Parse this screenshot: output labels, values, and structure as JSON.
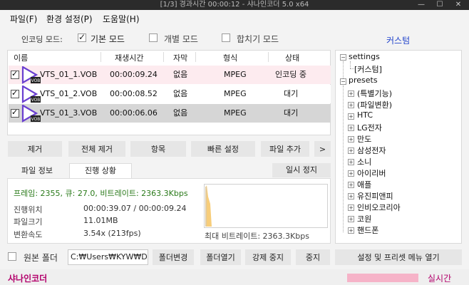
{
  "window": {
    "title": "[1/3] 경과시간 00:00:12 - 샤나인코더 5.0 x64",
    "minimize_glyph": "—",
    "maximize_glyph": "☐",
    "close_glyph": "✕"
  },
  "menu": {
    "file": "파일(F)",
    "settings": "환경 설정(P)",
    "help": "도움말(H)"
  },
  "encoding_mode": {
    "label": "인코딩 모드:",
    "basic": "기본 모드",
    "individual": "개별 모드",
    "merge": "합치기 모드",
    "basic_checked": true,
    "individual_checked": false,
    "merge_checked": false,
    "custom_link": "커스텀"
  },
  "file_list": {
    "headers": {
      "name": "이름",
      "duration": "재생시간",
      "subtitle": "자막",
      "format": "형식",
      "status": "상태"
    },
    "icon_badge": "VOB",
    "rows": [
      {
        "name": "VTS_01_1.VOB",
        "duration": "00:00:09.24",
        "subtitle": "없음",
        "format": "MPEG",
        "status": "인코딩 중",
        "checked": true
      },
      {
        "name": "VTS_01_2.VOB",
        "duration": "00:00:08.52",
        "subtitle": "없음",
        "format": "MPEG",
        "status": "대기",
        "checked": true
      },
      {
        "name": "VTS_01_3.VOB",
        "duration": "00:00:06.06",
        "subtitle": "없음",
        "format": "MPEG",
        "status": "대기",
        "checked": true
      }
    ]
  },
  "list_buttons": {
    "remove": "제거",
    "remove_all": "전체 제거",
    "item": "항목",
    "quick_settings": "빠른 설정",
    "add_file": "파일 추가",
    "more": ">"
  },
  "tabs": {
    "file_info": "파일 정보",
    "progress": "진행 상황",
    "pause": "일시 정지"
  },
  "progress": {
    "headline": "프레임: 2355, 큐: 27.0, 비트레이트: 2363.3Kbps",
    "position_label": "진행위치",
    "position_value": "00:00:39.07 / 00:00:09.24",
    "filesize_label": "파일크기",
    "filesize_value": "11.01MB",
    "speed_label": "변환속도",
    "speed_value": "3.54x (213fps)",
    "max_bitrate": "최대 비트레이트: 2363.3Kbps"
  },
  "tree": {
    "root_settings": "settings",
    "custom": "[커스텀]",
    "root_presets": "presets",
    "presets": [
      "(특별기능)",
      "(파일변환)",
      "HTC",
      "LG전자",
      "만도",
      "삼성전자",
      "소니",
      "아이리버",
      "애플",
      "유진피앤피",
      "인비오코리아",
      "코원",
      "핸드폰"
    ]
  },
  "bottom": {
    "source_folder_label": "원본 폴더",
    "source_folder_checked": false,
    "path_value": "C:₩Users₩KYW₩Desk",
    "change_folder": "폴더변경",
    "open_folder": "폴더열기",
    "force_stop": "강제 중지",
    "stop": "중지",
    "preset_menu": "설정 및 프리셋 메뉴 열기"
  },
  "statusbar": {
    "app_name": "샤나인코더",
    "realtime": "실시간"
  },
  "colors": {
    "accent": "#b3006b",
    "link_blue": "#2244cc",
    "green_text": "#2a7a1a",
    "encoding_row": "#fdebef",
    "selected_row": "#d6d6d6",
    "chart_fill": "#f7cd7a",
    "realtime_bar": "#f6b3c8"
  }
}
